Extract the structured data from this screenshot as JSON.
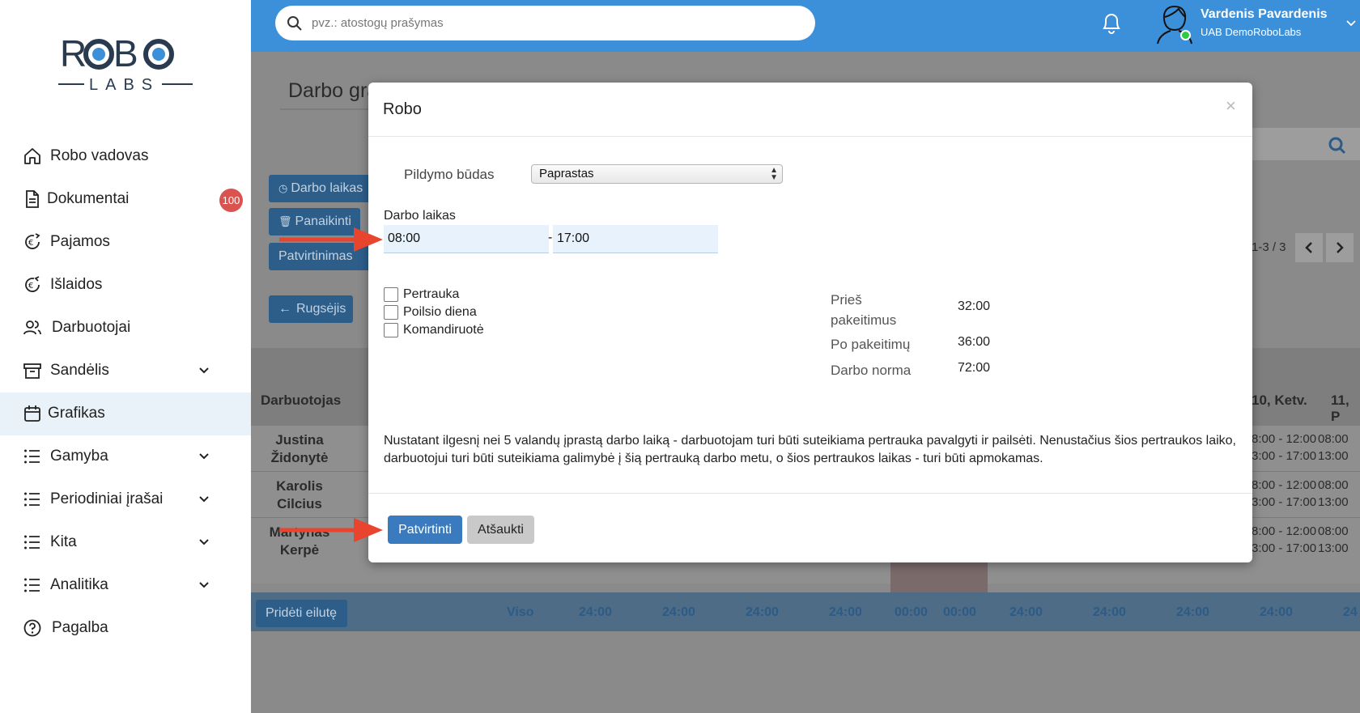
{
  "sidebar": {
    "logo_top": "ROBO",
    "logo_bottom": "LABS",
    "items": [
      {
        "label": "Robo vadovas",
        "icon": "home-icon"
      },
      {
        "label": "Dokumentai",
        "icon": "document-icon",
        "badge": "100"
      },
      {
        "label": "Pajamos",
        "icon": "income-icon"
      },
      {
        "label": "Išlaidos",
        "icon": "expenses-icon"
      },
      {
        "label": "Darbuotojai",
        "icon": "employees-icon"
      },
      {
        "label": "Sandėlis",
        "icon": "warehouse-icon"
      },
      {
        "label": "Grafikas",
        "icon": "calendar-icon",
        "active": true
      },
      {
        "label": "Gamyba",
        "icon": "list-icon"
      },
      {
        "label": "Periodiniai įrašai",
        "icon": "list-icon"
      },
      {
        "label": "Kita",
        "icon": "list-icon"
      },
      {
        "label": "Analitika",
        "icon": "list-icon"
      },
      {
        "label": "Pagalba",
        "icon": "help-icon"
      }
    ]
  },
  "header": {
    "search_placeholder": "pvz.: atostogų prašymas",
    "user_name": "Vardenis Pavardenis",
    "user_company": "UAB DemoRoboLabs"
  },
  "background": {
    "page_title": "Darbo gra",
    "btn_work_time": "Darbo laikas",
    "btn_delete": "Panaikinti",
    "btn_confirmation": "Patvirtinimas",
    "btn_month": "Rugsėjis",
    "pagination": "1-3 / 3",
    "col_employee": "Darbuotojas",
    "col_day10": "10, Ketv.",
    "col_day11": "11, P",
    "employees": [
      {
        "first": "Justina",
        "last": "Židonytė"
      },
      {
        "first": "Karolis",
        "last": "Cilcius"
      },
      {
        "first": "Martynas",
        "last": "Kerpė"
      }
    ],
    "time_a1": "8:00 - 12:00",
    "time_a2": "3:00 - 17:00",
    "time_b1": "08:00",
    "time_b2": "13:00",
    "add_row": "Pridėti eilutę",
    "total_label": "Viso",
    "totals": [
      "24:00",
      "24:00",
      "24:00",
      "24:00",
      "00:00",
      "00:00",
      "24:00",
      "24:00",
      "24:00",
      "24:00",
      "24"
    ]
  },
  "modal": {
    "title": "Robo",
    "close": "×",
    "fill_mode_label": "Pildymo būdas",
    "fill_mode_value": "Paprastas",
    "work_time_label": "Darbo laikas",
    "time_from": "08:00",
    "time_separator": "-",
    "time_to": "17:00",
    "checkboxes": [
      "Pertrauka",
      "Poilsio diena",
      "Komandiruotė"
    ],
    "stats": {
      "before_label_1": "Prieš",
      "before_label_2": "pakeitimus",
      "before_value": "32:00",
      "after_label": "Po pakeitimų",
      "after_value": "36:00",
      "norm_label": "Darbo norma",
      "norm_value": "72:00"
    },
    "notice": "Nustatant ilgesnį nei 5 valandų įprastą darbo laiką - darbuotojam turi būti suteikiama pertrauka pavalgyti ir pailsėti. Nenustačius šios pertraukos laiko, darbuotojui turi būti suteikiama galimybė į šią pertrauką darbo metu, o šios pertraukos laikas - turi būti apmokamas.",
    "confirm_label": "Patvirtinti",
    "cancel_label": "Atšaukti"
  },
  "colors": {
    "header_blue": "#3c90d9",
    "badge_red": "#d9534f",
    "primary_button": "#3a7bbf",
    "arrow_red": "#e8442e"
  }
}
